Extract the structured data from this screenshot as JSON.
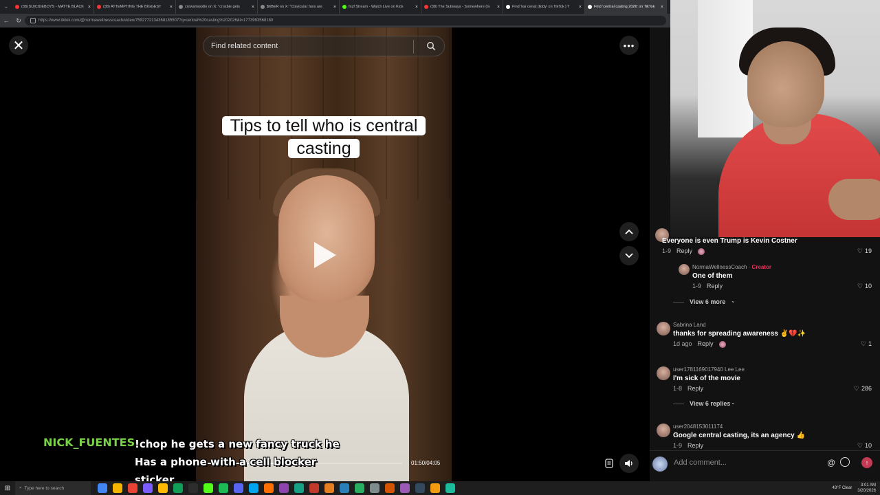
{
  "browser": {
    "tabs": [
      {
        "label": "(38) $UICIDEBOYS - MATTE BLACK",
        "color": "#ff3333",
        "active": false
      },
      {
        "label": "(38) ATTEMPTING THE BIGGEST",
        "color": "#ff3333",
        "active": false
      },
      {
        "label": "crowsmoodle on X: \"crosbie gets",
        "color": "#888888",
        "active": false
      },
      {
        "label": "$6BER on X: \"Clavicular fans are",
        "color": "#888888",
        "active": false
      },
      {
        "label": "fozf Stream - Watch Live on Kick",
        "color": "#53fc18",
        "active": false
      },
      {
        "label": "(38) The Subways - Somewhere (G",
        "color": "#ff3333",
        "active": false
      },
      {
        "label": "Find 'kai cenat diddy' on TikTok | T",
        "color": "#ffffff",
        "active": false
      },
      {
        "label": "Find 'central casting 2026' on TikTok",
        "color": "#ffffff",
        "active": true
      }
    ],
    "url": "https://www.tiktok.com/@normawellnesscoach/video/7592772134368185507?q=central%20casting%202026&t=1773993568180"
  },
  "video": {
    "search_placeholder": "Find related content",
    "caption": "Tips to tell who is central casting",
    "timecode": "01:50/04:05",
    "progress": 0.4
  },
  "side": {
    "tag": "#c",
    "note": "♫"
  },
  "chat": {
    "username": "NICK_FUENTES",
    "message": "!chop he gets a new fancy truck he Has a phone with a cell blocker sticker"
  },
  "comments": [
    {
      "name": "",
      "text": "Everyone is even Trump is Kevin Costner",
      "date": "1-9",
      "reply": "Reply",
      "likes": "19"
    },
    {
      "name": "NormaWellnessCoach",
      "badge": "Creator",
      "text": "One of them",
      "date": "1-9",
      "reply": "Reply",
      "likes": "10"
    },
    {
      "viewmore": "View 6 more"
    },
    {
      "name": "Sabrina Land",
      "text": "thanks for spreading awareness ✌️💔✨",
      "date": "1d ago",
      "reply": "Reply",
      "likes": "1"
    },
    {
      "name": "user1781169017940 Lee Lee",
      "text": "I'm sick of the movie",
      "date": "1-8",
      "reply": "Reply",
      "likes": "286"
    },
    {
      "viewmore": "View 6 replies"
    },
    {
      "name": "user2048153011174",
      "text": "Google central casting, its an agency 👍",
      "date": "1-9",
      "reply": "Reply",
      "likes": "10"
    }
  ],
  "add_comment": {
    "placeholder": "Add comment..."
  },
  "taskbar": {
    "search": "Type here to search",
    "weather": "43°F Clear",
    "time": "3:01 AM",
    "date": "3/20/2026"
  }
}
